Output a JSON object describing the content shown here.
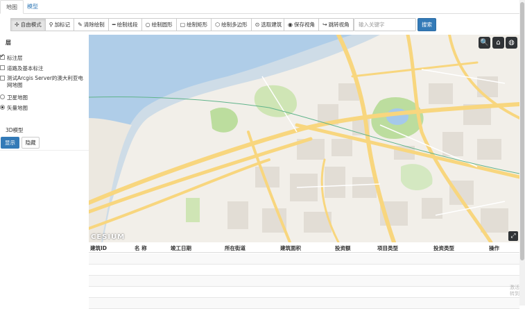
{
  "tabs": [
    {
      "label": "地图"
    },
    {
      "label": "模型"
    }
  ],
  "toolbar": {
    "buttons": [
      {
        "label": "自由模式",
        "icon": "move-icon",
        "glyph": "✢"
      },
      {
        "label": "加标记",
        "icon": "map-marker-icon",
        "glyph": "⚲"
      },
      {
        "label": "清除绘制",
        "icon": "eraser-icon",
        "glyph": "✎"
      },
      {
        "label": "绘制线段",
        "icon": "minus-icon",
        "glyph": "━"
      },
      {
        "label": "绘制圆形",
        "icon": "circle-icon",
        "glyph": "○"
      },
      {
        "label": "绘制矩形",
        "icon": "rectangle-icon",
        "glyph": "▢"
      },
      {
        "label": "绘制多边形",
        "icon": "polygon-map-icon",
        "glyph": "⬡"
      },
      {
        "label": "选取建筑",
        "icon": "pointer-icon",
        "glyph": "⊙"
      }
    ],
    "view_buttons": [
      {
        "label": "保存视角",
        "icon": "eye-icon",
        "glyph": "◉"
      },
      {
        "label": "跳转视角",
        "icon": "share-icon",
        "glyph": "↪"
      }
    ],
    "search_placeholder": "输入关键字",
    "search_label": "搜索"
  },
  "panel": {
    "title": "层",
    "layers": [
      {
        "label": "标注层",
        "type": "checkbox",
        "checked": true
      },
      {
        "label": "道路及基本标注",
        "type": "checkbox",
        "checked": false
      },
      {
        "label": "测试Arcgis Server的澳大利亚电网地图",
        "type": "checkbox",
        "checked": false
      },
      {
        "label": "卫星地图",
        "type": "radio",
        "checked": false
      },
      {
        "label": "矢量地图",
        "type": "radio",
        "checked": true
      }
    ],
    "model_title": "3D模型",
    "show_label": "显示",
    "hide_label": "隐藏"
  },
  "map": {
    "controls": [
      {
        "name": "search-icon",
        "glyph": "🔍"
      },
      {
        "name": "home-icon",
        "glyph": "⌂"
      },
      {
        "name": "globe-icon",
        "glyph": "◍"
      }
    ],
    "logo": "CESIUM",
    "fullscreen_glyph": "⤢"
  },
  "table": {
    "columns": [
      "建筑ID",
      "名 称",
      "竣工日期",
      "所在街道",
      "建筑面积",
      "投资额",
      "项目类型",
      "投资类型",
      "操作"
    ],
    "rows": [
      {},
      {},
      {},
      {},
      {}
    ]
  },
  "watermark": [
    "激活",
    "转到"
  ]
}
